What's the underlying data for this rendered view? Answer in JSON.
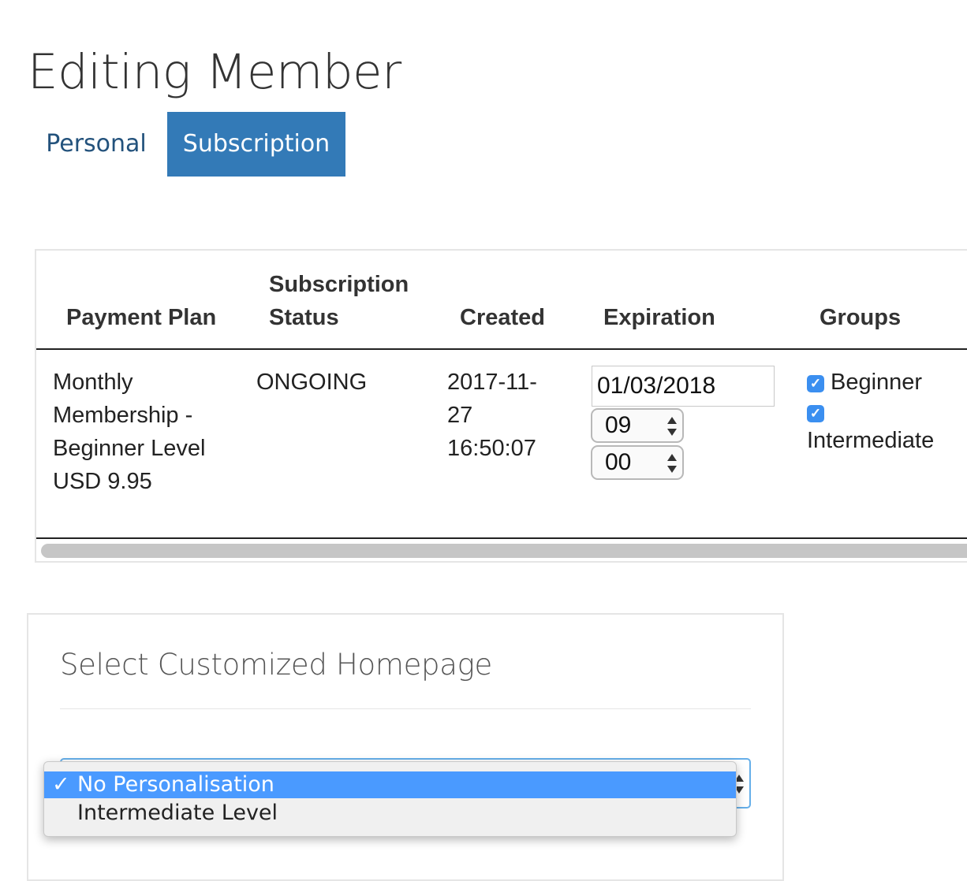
{
  "page": {
    "title": "Editing Member"
  },
  "tabs": [
    {
      "label": "Personal",
      "active": false
    },
    {
      "label": "Subscription",
      "active": true
    }
  ],
  "table": {
    "headers": {
      "payment_plan": "Payment Plan",
      "status_line1": "Subscription",
      "status_line2": "Status",
      "created": "Created",
      "expiration": "Expiration",
      "groups": "Groups"
    },
    "row": {
      "plan_lines": [
        "Monthly",
        "Membership -",
        "Beginner Level",
        "USD 9.95"
      ],
      "status": "ONGOING",
      "created_lines": [
        "2017-11-",
        "27",
        "16:50:07"
      ],
      "expiration_date": "01/03/2018",
      "expiration_hour": "09",
      "expiration_minute": "00",
      "groups": [
        {
          "label": "Beginner",
          "checked": true
        },
        {
          "label": "Intermediate",
          "checked": true
        }
      ]
    }
  },
  "homepage": {
    "title": "Select Customized Homepage",
    "options": [
      {
        "label": "No Personalisation",
        "selected": true
      },
      {
        "label": "Intermediate Level",
        "selected": false
      }
    ],
    "check_glyph": "✓"
  },
  "colors": {
    "accent": "#337ab7",
    "link": "#23527c",
    "checkbox": "#3b8ff0",
    "option_highlight": "#4a9aff"
  }
}
